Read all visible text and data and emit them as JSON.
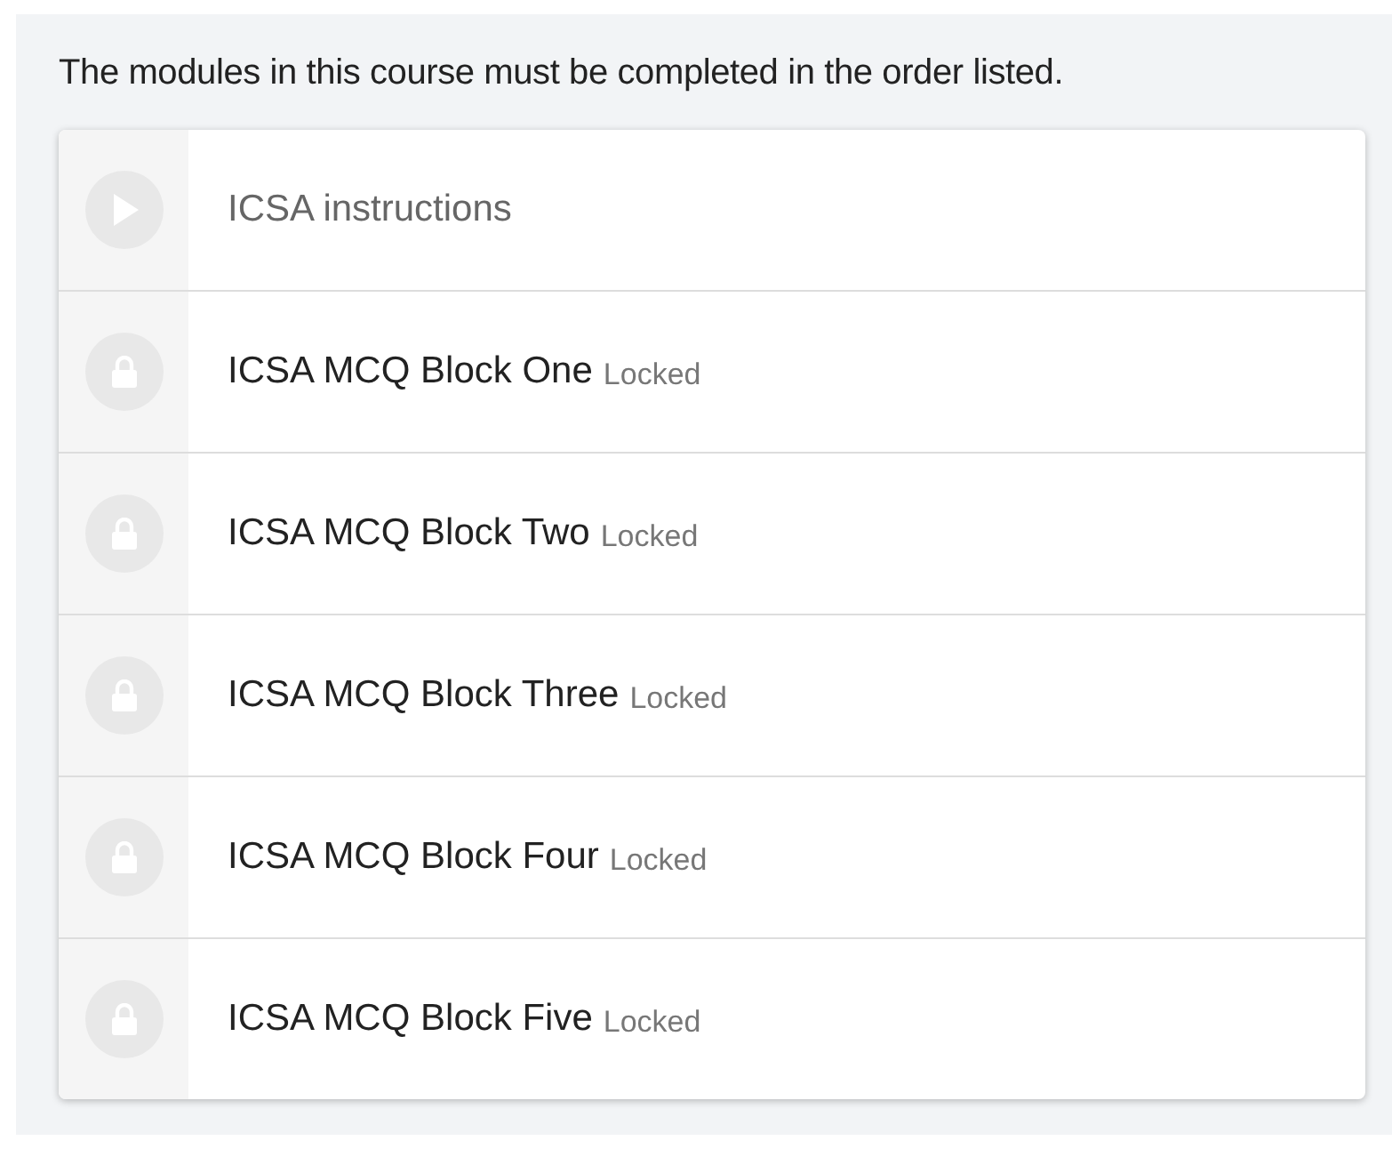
{
  "notice": "The modules in this course must be completed in the order listed.",
  "modules": [
    {
      "kind": "start",
      "title": "ICSA instructions"
    },
    {
      "kind": "locked",
      "title": "ICSA MCQ Block One",
      "status": "Locked"
    },
    {
      "kind": "locked",
      "title": "ICSA MCQ Block Two",
      "status": "Locked"
    },
    {
      "kind": "locked",
      "title": "ICSA MCQ Block Three",
      "status": "Locked"
    },
    {
      "kind": "locked",
      "title": "ICSA MCQ Block Four",
      "status": "Locked"
    },
    {
      "kind": "locked",
      "title": "ICSA MCQ Block Five",
      "status": "Locked"
    }
  ]
}
